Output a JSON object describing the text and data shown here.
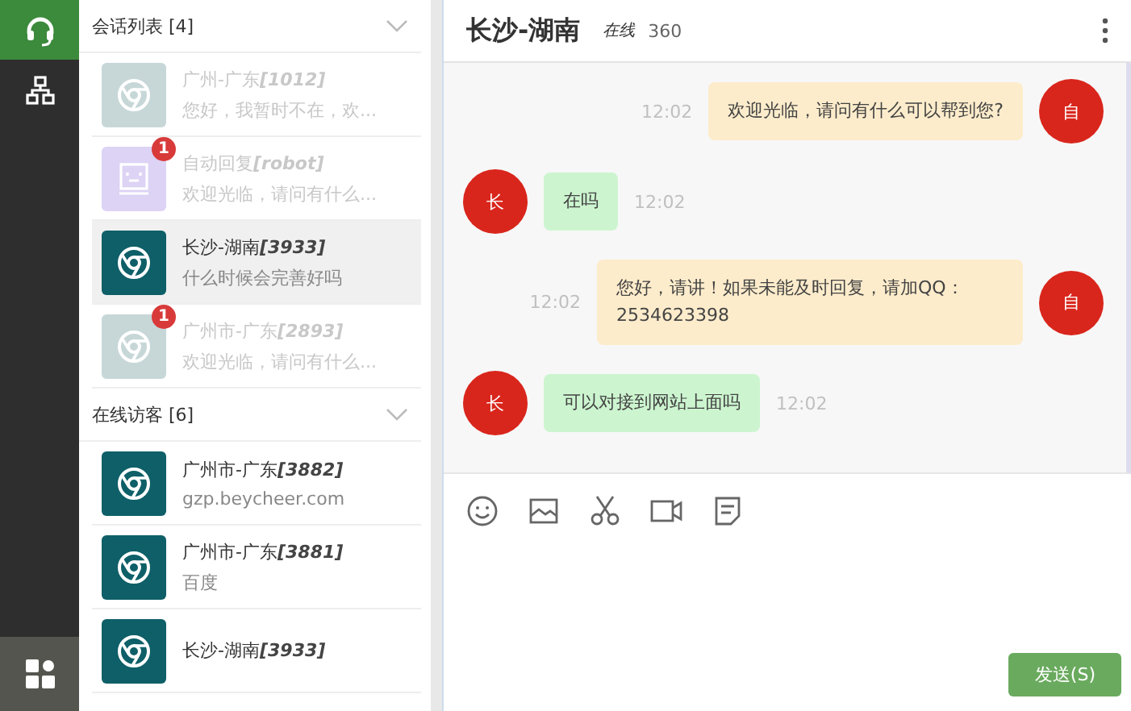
{
  "rail": {
    "items": [
      {
        "selected": true
      },
      {
        "selected": false
      }
    ]
  },
  "sections": [
    {
      "title": "会话列表 [4]",
      "expanded": true,
      "items": [
        {
          "name": "广州-广东",
          "id": "[1012]",
          "subtitle": "您好，我暂时不在，欢...",
          "kind": "browser",
          "dimmed": true,
          "selected": false
        },
        {
          "name": "自动回复",
          "id": "[robot]",
          "subtitle": "欢迎光临，请问有什么...",
          "kind": "robot",
          "dimmed": true,
          "selected": false,
          "badge": "1"
        },
        {
          "name": "长沙-湖南",
          "id": "[3933]",
          "subtitle": "什么时候会完善好吗",
          "kind": "browser",
          "dimmed": false,
          "selected": true
        },
        {
          "name": "广州市-广东",
          "id": "[2893]",
          "subtitle": "欢迎光临，请问有什么...",
          "kind": "browser",
          "dimmed": true,
          "selected": false,
          "badge": "1"
        }
      ]
    },
    {
      "title": "在线访客 [6]",
      "expanded": true,
      "items": [
        {
          "name": "广州市-广东",
          "id": "[3882]",
          "subtitle": "gzp.beycheer.com",
          "kind": "browser",
          "dimmed": false,
          "selected": false
        },
        {
          "name": "广州市-广东",
          "id": "[3881]",
          "subtitle": "百度",
          "kind": "browser",
          "dimmed": false,
          "selected": false
        },
        {
          "name": "长沙-湖南",
          "id": "[3933]",
          "kind": "browser",
          "dimmed": false,
          "selected": false
        }
      ]
    }
  ],
  "chat": {
    "title": "长沙-湖南",
    "status": "在线",
    "source": "360",
    "messages": [
      {
        "kind": "agent",
        "avatar": "自",
        "text": "欢迎光临，请问有什么可以帮到您?",
        "time": "12:02"
      },
      {
        "kind": "visitor",
        "avatar": "长",
        "text": "在吗",
        "time": "12:02"
      },
      {
        "kind": "agent",
        "avatar": "自",
        "text": "您好，请讲！如果未能及时回复，请加QQ：2534623398",
        "time": "12:02"
      },
      {
        "kind": "visitor",
        "avatar": "长",
        "text": "可以对接到网站上面吗",
        "time": "12:02"
      }
    ],
    "tools": [
      {
        "kind": "emoji"
      },
      {
        "kind": "image"
      },
      {
        "kind": "scissors"
      },
      {
        "kind": "video"
      },
      {
        "kind": "note"
      }
    ],
    "send": "发送(S)"
  }
}
